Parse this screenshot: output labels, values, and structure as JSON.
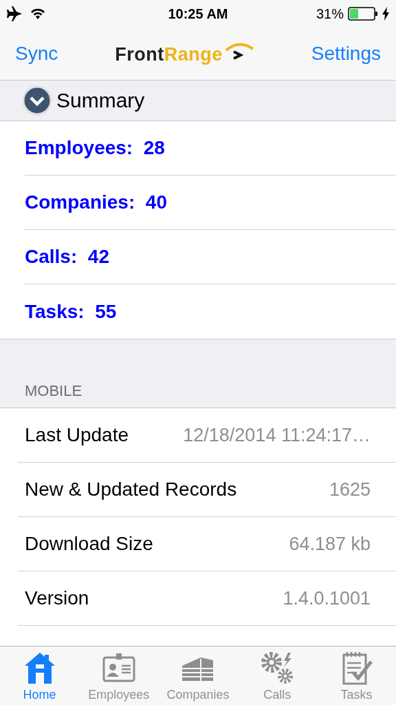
{
  "status_bar": {
    "time": "10:25 AM",
    "battery": "31%"
  },
  "nav": {
    "left": "Sync",
    "logo_front": "Front",
    "logo_range": "Range",
    "right": "Settings"
  },
  "summary": {
    "title": "Summary",
    "expanded": true,
    "rows": [
      {
        "text": "Employees:  28"
      },
      {
        "text": "Companies:  40"
      },
      {
        "text": "Calls:  42"
      },
      {
        "text": "Tasks:  55"
      }
    ]
  },
  "mobile": {
    "header": "MOBILE",
    "rows": [
      {
        "label": "Last Update",
        "value": "12/18/2014 11:24:17…"
      },
      {
        "label": "New & Updated Records",
        "value": "1625"
      },
      {
        "label": "Download Size",
        "value": "64.187 kb"
      },
      {
        "label": "Version",
        "value": "1.4.0.1001"
      }
    ]
  },
  "tabs": [
    {
      "label": "Home",
      "selected": true
    },
    {
      "label": "Employees",
      "selected": false
    },
    {
      "label": "Companies",
      "selected": false
    },
    {
      "label": "Calls",
      "selected": false
    },
    {
      "label": "Tasks",
      "selected": false
    }
  ]
}
